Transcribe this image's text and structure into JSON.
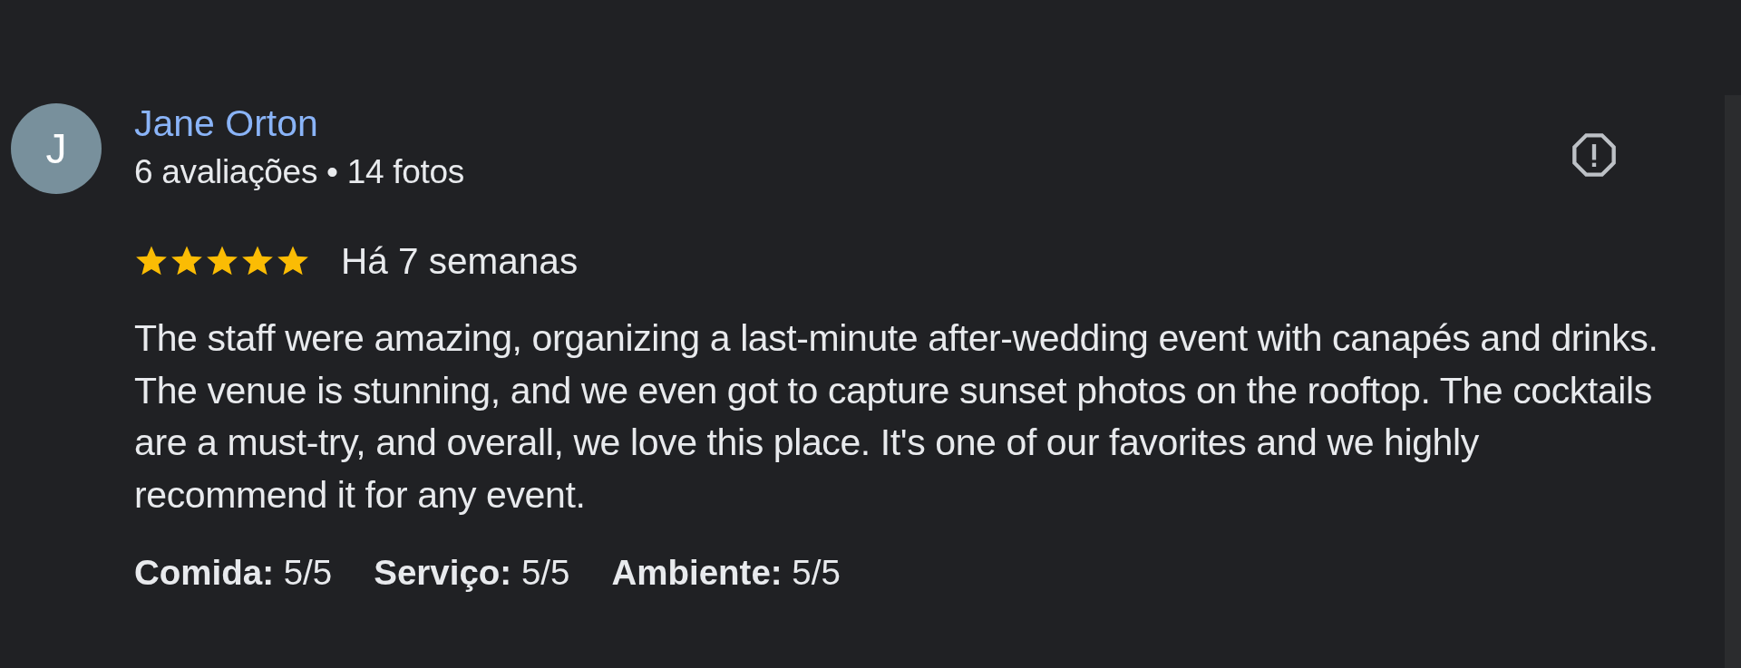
{
  "review": {
    "avatar_letter": "J",
    "author": "Jane Orton",
    "meta": "6 avaliações • 14 fotos",
    "stars": 5,
    "date": "Há 7 semanas",
    "text": "The staff were amazing, organizing a last-minute after-wedding event with canapés and drinks. The venue is stunning, and we even got to capture sunset photos on the rooftop. The cocktails are a must-try, and overall, we love this place. It's one of our favorites and we highly recommend it for any event.",
    "ratings": [
      {
        "label": "Comida:",
        "value": "5/5"
      },
      {
        "label": "Serviço:",
        "value": "5/5"
      },
      {
        "label": "Ambiente:",
        "value": "5/5"
      }
    ]
  }
}
